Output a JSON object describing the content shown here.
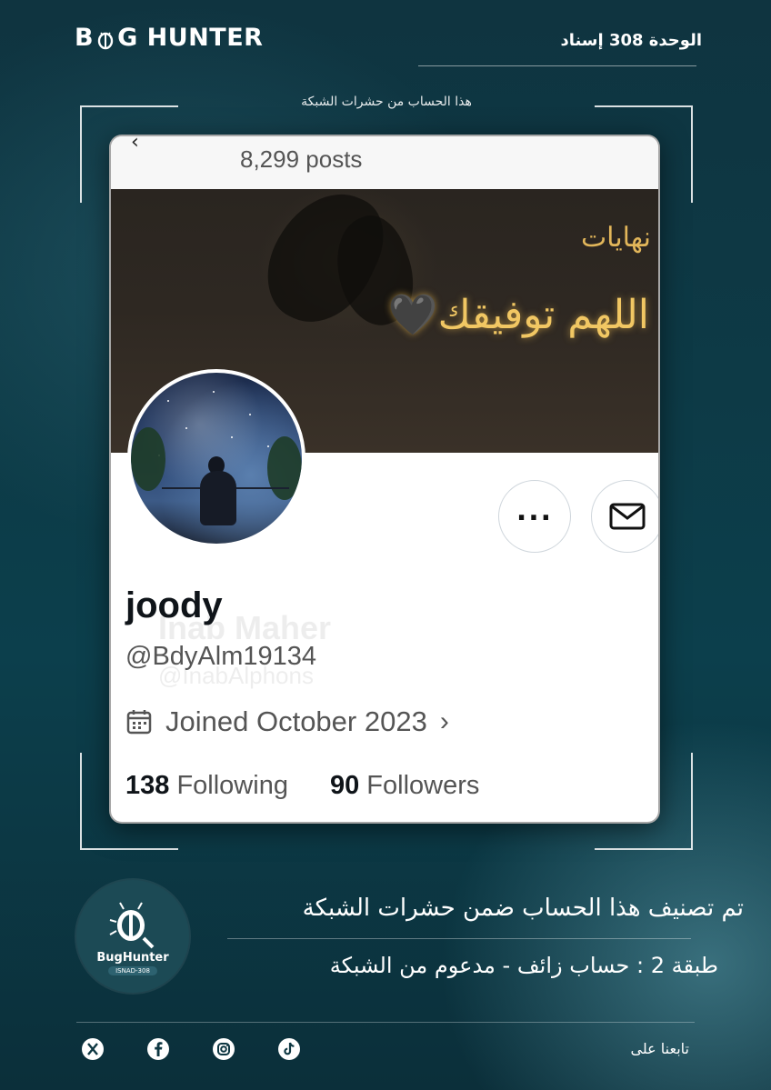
{
  "header": {
    "brand": "B   G HUNTER",
    "brand_left": "B",
    "brand_right": "G HUNTER",
    "unit_label": "الوحدة 308 إسناد"
  },
  "frame": {
    "caption": "هذا الحساب من حشرات الشبكة"
  },
  "profile": {
    "posts_count": "8,299 posts",
    "banner_text_1": "نهايات",
    "banner_text_2": "اللهم توفيقك🖤",
    "name": "joody",
    "handle": "@BdyAlm19134",
    "joined": "Joined October 2023",
    "following_count": "138",
    "following_label": "Following",
    "followers_count": "90",
    "followers_label": "Followers",
    "ghost_name": "Inab Maher",
    "ghost_handle": "@InabAlphons"
  },
  "classification": {
    "logo_text": "BugHunter",
    "logo_tag": "ISNAD-308",
    "main": "تم تصنيف هذا الحساب ضمن حشرات الشبكة",
    "sub": "طبقة 2 : حساب زائف - مدعوم من الشبكة"
  },
  "footer": {
    "follow_us": "تابعنا على",
    "socials": [
      "x-icon",
      "facebook-icon",
      "instagram-icon",
      "tiktok-icon"
    ]
  }
}
